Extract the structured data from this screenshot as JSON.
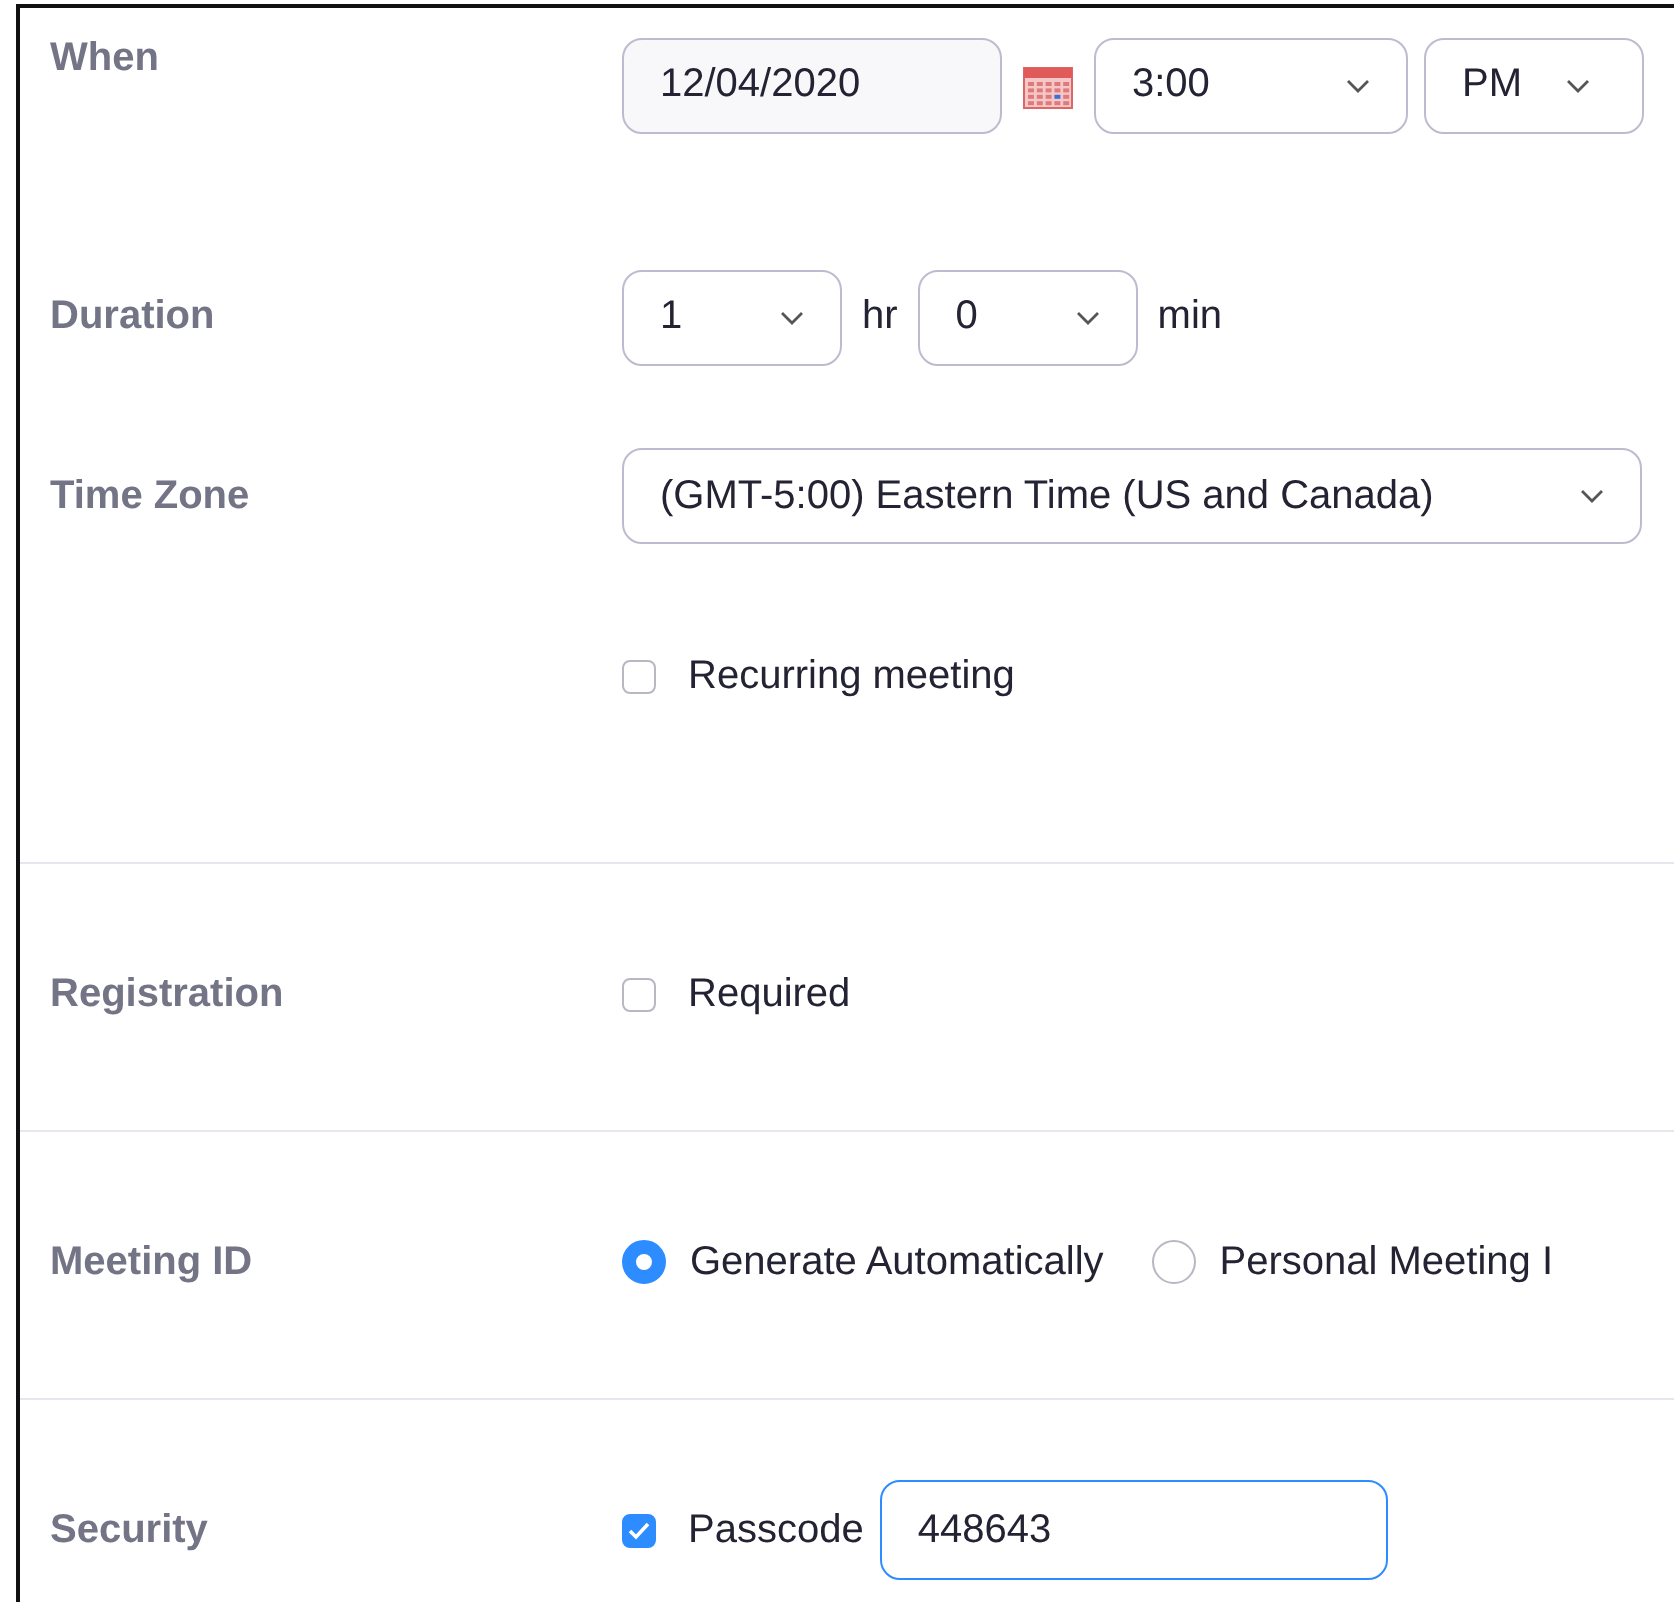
{
  "when": {
    "label": "When",
    "date": "12/04/2020",
    "time": "3:00",
    "ampm": "PM"
  },
  "duration": {
    "label": "Duration",
    "hours": "1",
    "hours_unit": "hr",
    "minutes": "0",
    "minutes_unit": "min"
  },
  "time_zone": {
    "label": "Time Zone",
    "value": "(GMT-5:00) Eastern Time (US and Canada)",
    "recurring": {
      "label": "Recurring meeting",
      "checked": false
    }
  },
  "registration": {
    "label": "Registration",
    "required": {
      "label": "Required",
      "checked": false
    }
  },
  "meeting_id": {
    "label": "Meeting ID",
    "options": [
      {
        "label": "Generate Automatically",
        "selected": true
      },
      {
        "label": "Personal Meeting I",
        "selected": false
      }
    ]
  },
  "security": {
    "label": "Security",
    "passcode": {
      "label": "Passcode",
      "checked": true,
      "value": "448643"
    }
  }
}
